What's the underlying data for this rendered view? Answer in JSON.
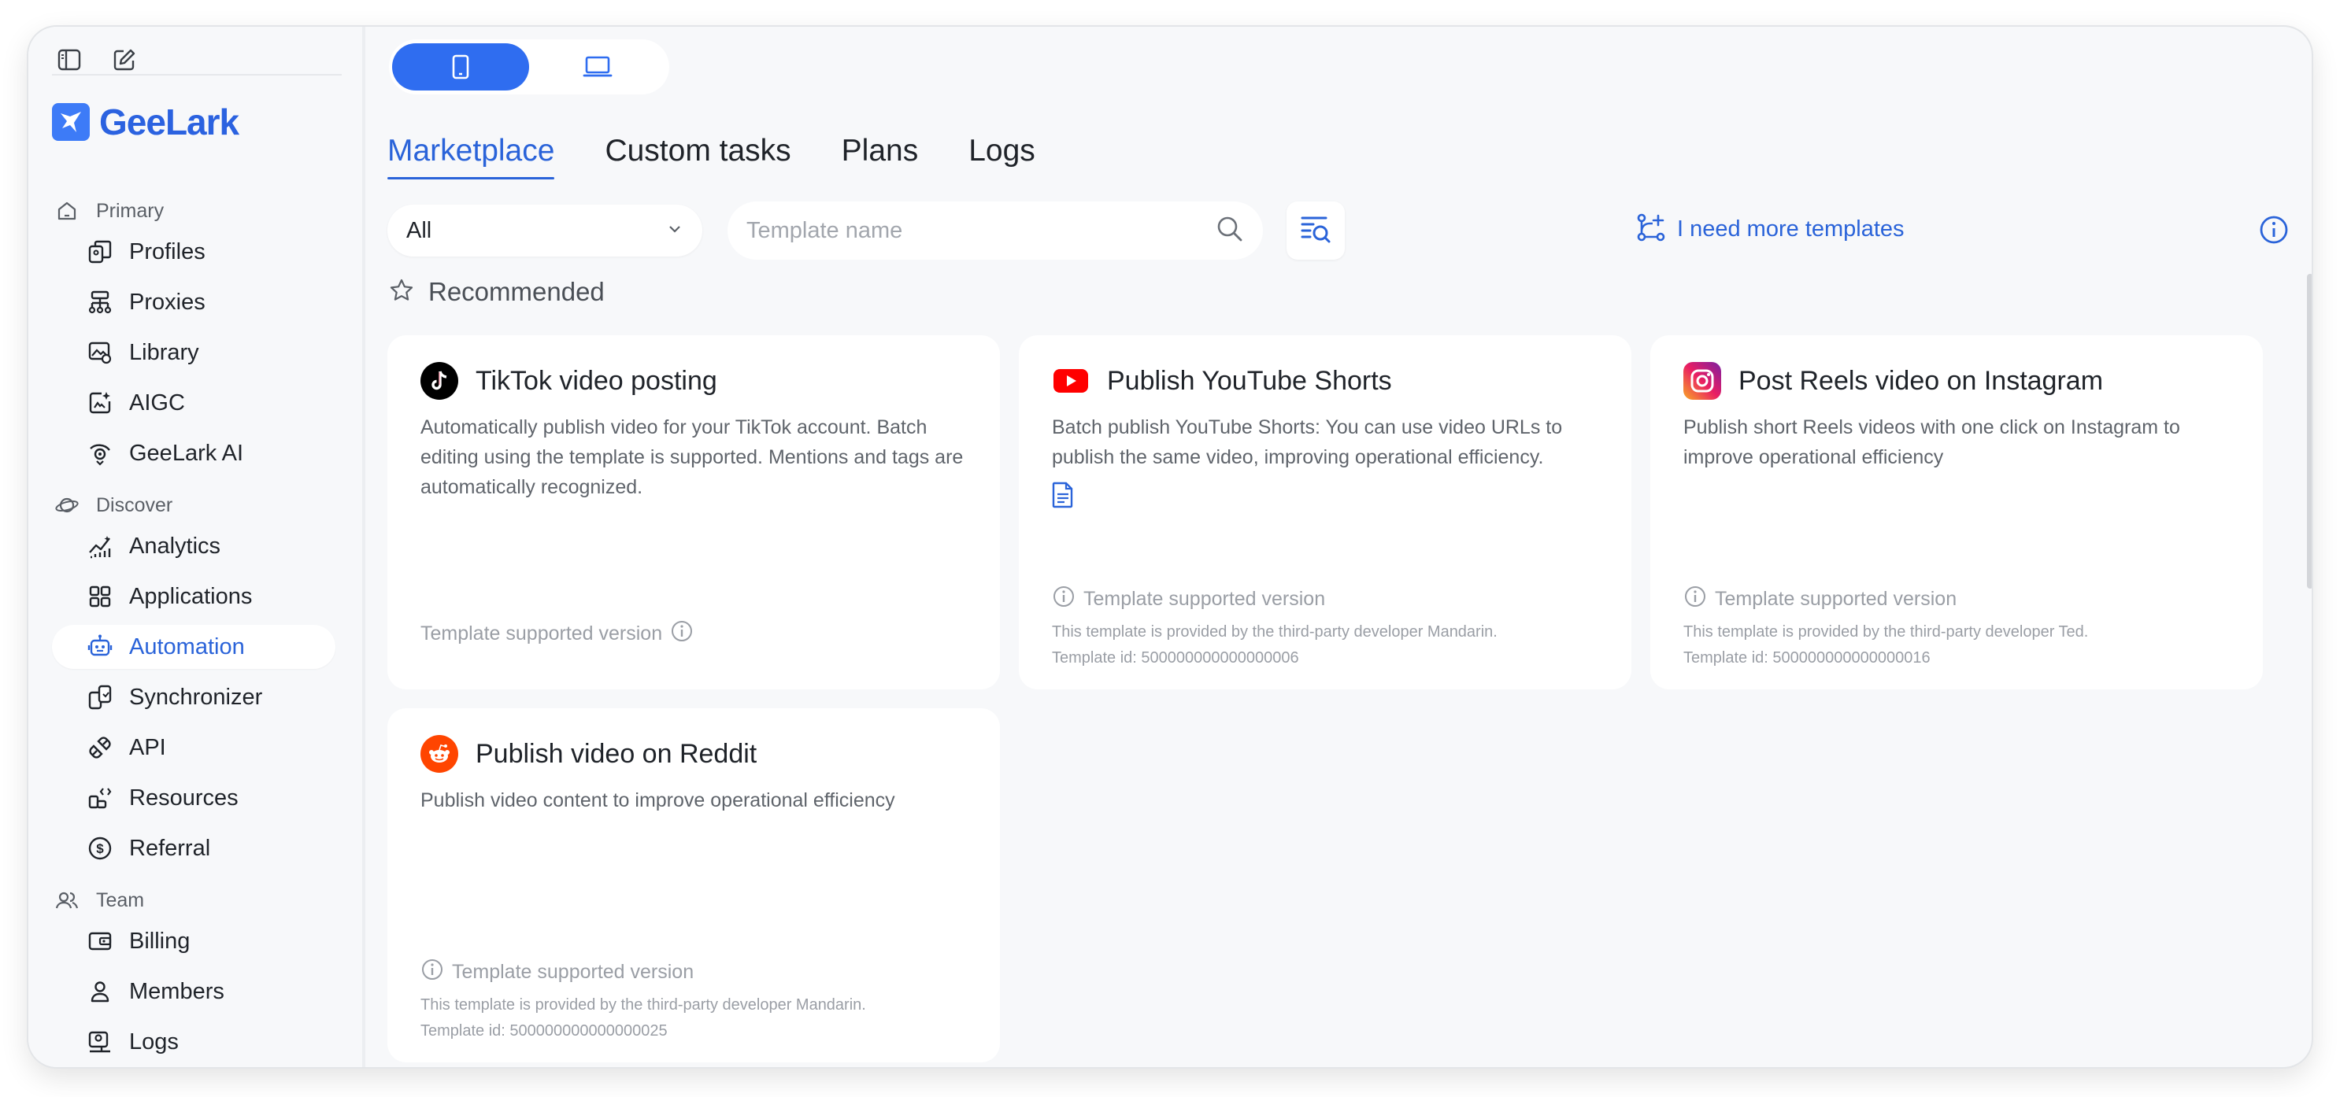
{
  "brand": {
    "name": "GeeLark"
  },
  "sidebar": {
    "sections": [
      {
        "label": "Primary",
        "items": [
          {
            "label": "Profiles",
            "icon": "profiles-icon"
          },
          {
            "label": "Proxies",
            "icon": "proxies-icon"
          },
          {
            "label": "Library",
            "icon": "library-icon"
          },
          {
            "label": "AIGC",
            "icon": "aigc-icon"
          },
          {
            "label": "GeeLark AI",
            "icon": "geelark-ai-icon"
          }
        ]
      },
      {
        "label": "Discover",
        "items": [
          {
            "label": "Analytics",
            "icon": "analytics-icon"
          },
          {
            "label": "Applications",
            "icon": "applications-icon"
          },
          {
            "label": "Automation",
            "icon": "automation-icon",
            "active": true
          },
          {
            "label": "Synchronizer",
            "icon": "synchronizer-icon"
          },
          {
            "label": "API",
            "icon": "api-icon"
          },
          {
            "label": "Resources",
            "icon": "resources-icon"
          },
          {
            "label": "Referral",
            "icon": "referral-icon"
          }
        ]
      },
      {
        "label": "Team",
        "items": [
          {
            "label": "Billing",
            "icon": "billing-icon"
          },
          {
            "label": "Members",
            "icon": "members-icon"
          },
          {
            "label": "Logs",
            "icon": "logs-icon"
          }
        ]
      }
    ]
  },
  "tabs": [
    "Marketplace",
    "Custom tasks",
    "Plans",
    "Logs"
  ],
  "filter": {
    "selected": "All",
    "search_placeholder": "Template name"
  },
  "more_templates_label": "I need more templates",
  "recommended_label": "Recommended",
  "colors": {
    "accent": "#2a63d9",
    "tiktok": "#000000",
    "youtube": "#ff0000",
    "reddit": "#ff4500"
  },
  "cards": [
    {
      "title": "TikTok video posting",
      "logo": "tiktok-logo-icon",
      "description": "Automatically publish video for your TikTok account. Batch editing using the template is supported. Mentions and tags are automatically recognized.",
      "version_label": "Template supported version"
    },
    {
      "title": "Publish YouTube Shorts",
      "logo": "youtube-logo-icon",
      "description": "Batch publish YouTube Shorts: You can use video URLs to publish the same video, improving operational efficiency.",
      "version_label": "Template supported version",
      "developer_line": "This template is provided by the third-party developer Mandarin.",
      "id_line": "Template id: 500000000000000006"
    },
    {
      "title": "Post Reels video on Instagram",
      "logo": "instagram-logo-icon",
      "description": "Publish short Reels videos with one click on Instagram to improve operational efficiency",
      "version_label": "Template supported version",
      "developer_line": "This template is provided by the third-party developer Ted.",
      "id_line": "Template id: 500000000000000016"
    },
    {
      "title": "Publish video on Reddit",
      "logo": "reddit-logo-icon",
      "description": "Publish video content to improve operational efficiency",
      "version_label": "Template supported version",
      "developer_line": "This template is provided by the third-party developer Mandarin.",
      "id_line": "Template id: 500000000000000025"
    }
  ]
}
